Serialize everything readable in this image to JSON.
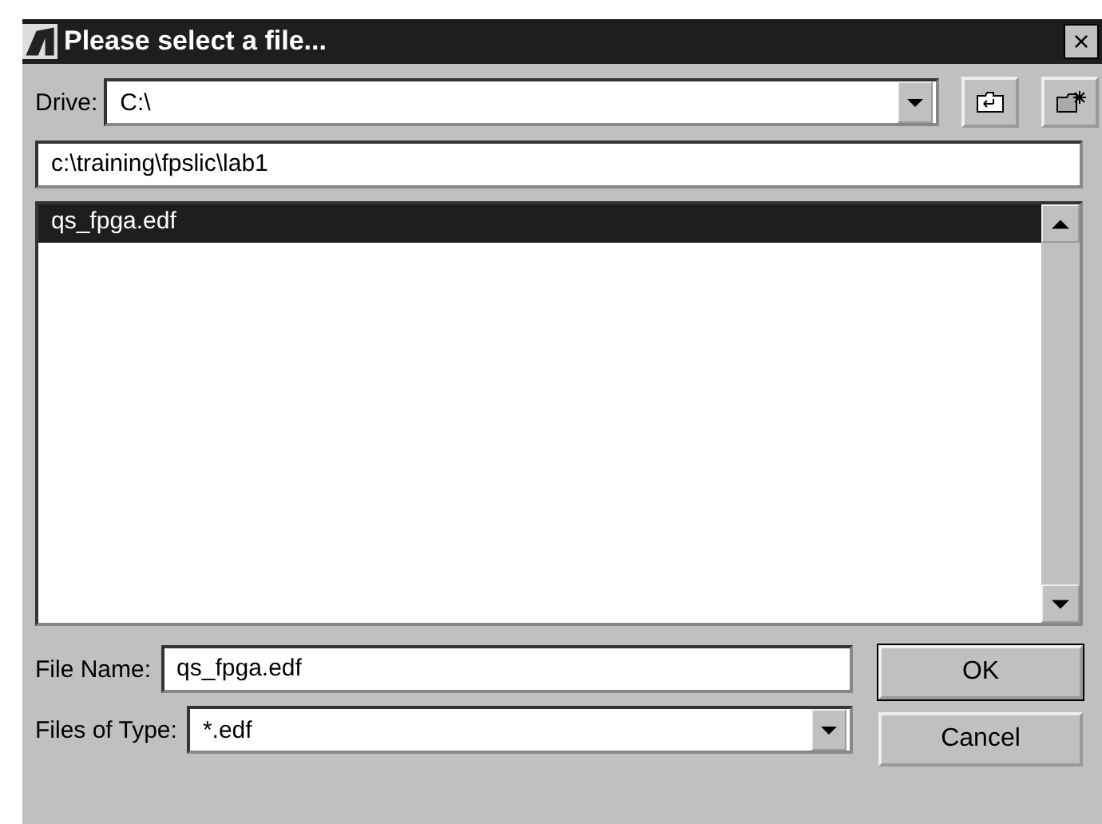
{
  "window": {
    "title": "Please select a file...",
    "close": "×"
  },
  "drive": {
    "label": "Drive:",
    "value": "C:\\"
  },
  "path": {
    "value": "c:\\training\\fpslic\\lab1"
  },
  "files": [
    {
      "name": "qs_fpga.edf",
      "selected": true
    }
  ],
  "file_name": {
    "label": "File Name:",
    "value": "qs_fpga.edf"
  },
  "file_type": {
    "label": "Files of Type:",
    "value": "*.edf"
  },
  "buttons": [
    {
      "label": "OK",
      "default": true
    },
    {
      "label": "Cancel",
      "default": false
    }
  ]
}
